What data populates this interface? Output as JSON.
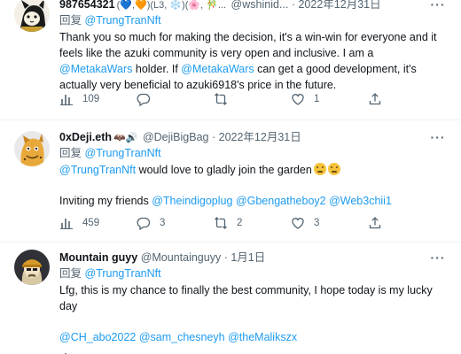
{
  "tweets": [
    {
      "author_name": "987654321",
      "name_emoji": "(💙,🧡)(L3, ❄️)(🌸, 🎋...",
      "handle": "@wshinid...",
      "separator": "·",
      "date": "2022年12月31日",
      "more": "···",
      "reply_prefix": "回复",
      "reply_to": "@TrungTranNft",
      "text": [
        [
          {
            "t": "Thank you so much for making the decision, it's a win-win for everyone and it feels like the azuki community is very open and inclusive. I am a "
          },
          {
            "t": "@MetakaWars",
            "link": true
          },
          {
            "t": " holder. If "
          },
          {
            "t": "@MetakaWars",
            "link": true
          },
          {
            "t": " can get a good development, it's actually very beneficial to azuki6918's price in the future."
          }
        ]
      ],
      "stats": {
        "views": "109",
        "replies": "",
        "retweets": "",
        "likes": "1"
      }
    },
    {
      "author_name": "0xDeji.eth",
      "name_emoji": "🦇🔊",
      "handle": "@DejiBigBag",
      "separator": "·",
      "date": "2022年12月31日",
      "more": "···",
      "reply_prefix": "回复",
      "reply_to": "@TrungTranNft",
      "text": [
        [
          {
            "t": "@TrungTranNft",
            "link": true
          },
          {
            "t": " would love to gladly join the garden"
          }
        ],
        [
          {
            "t": "Inviting my friends "
          },
          {
            "t": "@Theindigoplug",
            "link": true
          },
          {
            "t": " "
          },
          {
            "t": "@Gbengatheboy2",
            "link": true
          },
          {
            "t": " "
          },
          {
            "t": "@Web3chii1",
            "link": true
          }
        ]
      ],
      "emoji_after_first_line": 2,
      "stats": {
        "views": "459",
        "replies": "3",
        "retweets": "2",
        "likes": "3"
      }
    },
    {
      "author_name": "Mountain guyy",
      "name_emoji": "",
      "handle": "@Mountainguyy",
      "separator": "·",
      "date": "1月1日",
      "more": "···",
      "reply_prefix": "回复",
      "reply_to": "@TrungTranNft",
      "text": [
        [
          {
            "t": "Lfg, this is my chance to finally the best community, I hope today is my lucky day"
          }
        ],
        [
          {
            "t": "@CH_abo2022",
            "link": true
          },
          {
            "t": " "
          },
          {
            "t": "@sam_chesneyh",
            "link": true
          },
          {
            "t": " "
          },
          {
            "t": "@theMaliksz",
            "link": true
          },
          {
            "t": "x",
            "link": true
          }
        ]
      ],
      "stats": {
        "views": "",
        "replies": "",
        "retweets": "",
        "likes": ""
      }
    }
  ],
  "colors": {
    "link": "#1d9bf0",
    "muted": "#536471",
    "text": "#0f1419",
    "divider": "#eff3f4"
  },
  "icons": [
    "views-icon",
    "reply-icon",
    "retweet-icon",
    "like-icon",
    "share-icon",
    "more-icon"
  ]
}
